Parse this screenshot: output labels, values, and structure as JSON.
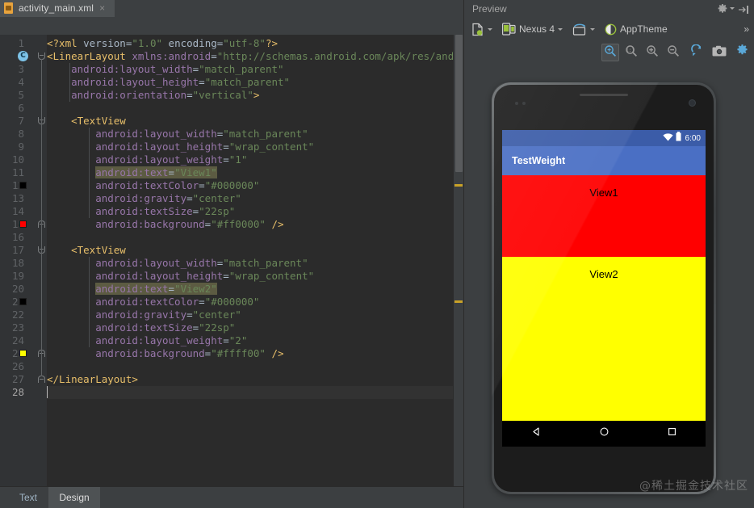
{
  "editor": {
    "tab": {
      "filename": "activity_main.xml",
      "close_glyph": "×",
      "icon": "xml-file-icon"
    },
    "bottom_tabs": [
      {
        "label": "Text",
        "active": false
      },
      {
        "label": "Design",
        "active": true
      }
    ],
    "caret_line": 28,
    "lines": [
      {
        "n": 1,
        "tokens": [
          {
            "t": "<?xml ",
            "c": "tag"
          },
          {
            "t": "version",
            "c": "plain"
          },
          {
            "t": "=",
            "c": "plain"
          },
          {
            "t": "\"1.0\"",
            "c": "val"
          },
          {
            "t": " encoding",
            "c": "plain"
          },
          {
            "t": "=",
            "c": "plain"
          },
          {
            "t": "\"utf-8\"",
            "c": "val"
          },
          {
            "t": "?>",
            "c": "tag"
          }
        ]
      },
      {
        "n": 2,
        "indent": 0,
        "tokens": [
          {
            "t": "<LinearLayout",
            "c": "tag"
          },
          {
            "t": " xmlns:android",
            "c": "attr"
          },
          {
            "t": "=",
            "c": "plain"
          },
          {
            "t": "\"http://schemas.android.com/apk/res/android\"",
            "c": "val"
          }
        ]
      },
      {
        "n": 3,
        "tokens": [
          {
            "t": "    android:layout_width",
            "c": "attr"
          },
          {
            "t": "=",
            "c": "plain"
          },
          {
            "t": "\"match_parent\"",
            "c": "val"
          }
        ]
      },
      {
        "n": 4,
        "tokens": [
          {
            "t": "    android:layout_height",
            "c": "attr"
          },
          {
            "t": "=",
            "c": "plain"
          },
          {
            "t": "\"match_parent\"",
            "c": "val"
          }
        ]
      },
      {
        "n": 5,
        "tokens": [
          {
            "t": "    android:orientation",
            "c": "attr"
          },
          {
            "t": "=",
            "c": "plain"
          },
          {
            "t": "\"vertical\"",
            "c": "val"
          },
          {
            "t": ">",
            "c": "tag"
          }
        ]
      },
      {
        "n": 6,
        "tokens": []
      },
      {
        "n": 7,
        "tokens": [
          {
            "t": "    <TextView",
            "c": "tag"
          }
        ]
      },
      {
        "n": 8,
        "tokens": [
          {
            "t": "        android:layout_width",
            "c": "attr"
          },
          {
            "t": "=",
            "c": "plain"
          },
          {
            "t": "\"match_parent\"",
            "c": "val"
          }
        ]
      },
      {
        "n": 9,
        "tokens": [
          {
            "t": "        android:layout_height",
            "c": "attr"
          },
          {
            "t": "=",
            "c": "plain"
          },
          {
            "t": "\"wrap_content\"",
            "c": "val"
          }
        ]
      },
      {
        "n": 10,
        "tokens": [
          {
            "t": "        android:layout_weight",
            "c": "attr"
          },
          {
            "t": "=",
            "c": "plain"
          },
          {
            "t": "\"1\"",
            "c": "val"
          }
        ]
      },
      {
        "n": 11,
        "tokens": [
          {
            "t": "        ",
            "c": "plain"
          },
          {
            "t": "android:text",
            "c": "attr",
            "hl": true
          },
          {
            "t": "=",
            "c": "plain",
            "hl": true
          },
          {
            "t": "\"View1\"",
            "c": "val",
            "hl": true
          }
        ]
      },
      {
        "n": 12,
        "tokens": [
          {
            "t": "        android:textColor",
            "c": "attr"
          },
          {
            "t": "=",
            "c": "plain"
          },
          {
            "t": "\"#000000\"",
            "c": "val"
          }
        ]
      },
      {
        "n": 13,
        "tokens": [
          {
            "t": "        android:gravity",
            "c": "attr"
          },
          {
            "t": "=",
            "c": "plain"
          },
          {
            "t": "\"center\"",
            "c": "val"
          }
        ]
      },
      {
        "n": 14,
        "tokens": [
          {
            "t": "        android:textSize",
            "c": "attr"
          },
          {
            "t": "=",
            "c": "plain"
          },
          {
            "t": "\"22sp\"",
            "c": "val"
          }
        ]
      },
      {
        "n": 15,
        "tokens": [
          {
            "t": "        android:background",
            "c": "attr"
          },
          {
            "t": "=",
            "c": "plain"
          },
          {
            "t": "\"#ff0000\"",
            "c": "val"
          },
          {
            "t": " ",
            "c": "plain"
          },
          {
            "t": "/>",
            "c": "tag"
          }
        ]
      },
      {
        "n": 16,
        "tokens": []
      },
      {
        "n": 17,
        "tokens": [
          {
            "t": "    <TextView",
            "c": "tag"
          }
        ]
      },
      {
        "n": 18,
        "tokens": [
          {
            "t": "        android:layout_width",
            "c": "attr"
          },
          {
            "t": "=",
            "c": "plain"
          },
          {
            "t": "\"match_parent\"",
            "c": "val"
          }
        ]
      },
      {
        "n": 19,
        "tokens": [
          {
            "t": "        android:layout_height",
            "c": "attr"
          },
          {
            "t": "=",
            "c": "plain"
          },
          {
            "t": "\"wrap_content\"",
            "c": "val"
          }
        ]
      },
      {
        "n": 20,
        "tokens": [
          {
            "t": "        ",
            "c": "plain"
          },
          {
            "t": "android:text",
            "c": "attr",
            "hl": true
          },
          {
            "t": "=",
            "c": "plain",
            "hl": true
          },
          {
            "t": "\"View2\"",
            "c": "val",
            "hl": true
          }
        ]
      },
      {
        "n": 21,
        "tokens": [
          {
            "t": "        android:textColor",
            "c": "attr"
          },
          {
            "t": "=",
            "c": "plain"
          },
          {
            "t": "\"#000000\"",
            "c": "val"
          }
        ]
      },
      {
        "n": 22,
        "tokens": [
          {
            "t": "        android:gravity",
            "c": "attr"
          },
          {
            "t": "=",
            "c": "plain"
          },
          {
            "t": "\"center\"",
            "c": "val"
          }
        ]
      },
      {
        "n": 23,
        "tokens": [
          {
            "t": "        android:textSize",
            "c": "attr"
          },
          {
            "t": "=",
            "c": "plain"
          },
          {
            "t": "\"22sp\"",
            "c": "val"
          }
        ]
      },
      {
        "n": 24,
        "tokens": [
          {
            "t": "        android:layout_weight",
            "c": "attr"
          },
          {
            "t": "=",
            "c": "plain"
          },
          {
            "t": "\"2\"",
            "c": "val"
          }
        ]
      },
      {
        "n": 25,
        "tokens": [
          {
            "t": "        android:background",
            "c": "attr"
          },
          {
            "t": "=",
            "c": "plain"
          },
          {
            "t": "\"#ffff00\"",
            "c": "val"
          },
          {
            "t": " ",
            "c": "plain"
          },
          {
            "t": "/>",
            "c": "tag"
          }
        ]
      },
      {
        "n": 26,
        "tokens": []
      },
      {
        "n": 27,
        "tokens": [
          {
            "t": "</LinearLayout>",
            "c": "tag"
          }
        ]
      },
      {
        "n": 28,
        "tokens": []
      }
    ],
    "gutter_swatches": [
      {
        "line": 12,
        "color": "#000000",
        "name": "color-swatch-black"
      },
      {
        "line": 15,
        "color": "#ff0000",
        "name": "color-swatch-red"
      },
      {
        "line": 21,
        "color": "#000000",
        "name": "color-swatch-black"
      },
      {
        "line": 25,
        "color": "#ffff00",
        "name": "color-swatch-yellow"
      }
    ],
    "gutter_badges": [
      {
        "line": 2,
        "glyph": "C",
        "name": "class-badge"
      }
    ],
    "fold_markers": [
      {
        "line": 2,
        "type": "open"
      },
      {
        "line": 7,
        "type": "open"
      },
      {
        "line": 15,
        "type": "close"
      },
      {
        "line": 17,
        "type": "open"
      },
      {
        "line": 25,
        "type": "close"
      },
      {
        "line": 27,
        "type": "close"
      }
    ],
    "warning_markers": [
      {
        "line": 12,
        "color": "#c9a227"
      },
      {
        "line": 21,
        "color": "#c9a227"
      }
    ]
  },
  "preview": {
    "title": "Preview",
    "gear_icon": "gear-icon",
    "collapse_icon": "collapse-right-icon",
    "overflow_glyph": "»",
    "toolbar": [
      {
        "name": "device-config-dropdown",
        "icon": "android-config-icon",
        "label": ""
      },
      {
        "name": "device-dropdown",
        "icon": "device-icon",
        "label": "Nexus 4"
      },
      {
        "name": "orientation-dropdown",
        "icon": "orientation-icon",
        "label": ""
      },
      {
        "name": "theme-dropdown",
        "icon": "theme-icon",
        "label": "AppTheme"
      }
    ],
    "zoom_buttons": [
      {
        "name": "zoom-to-fit-button",
        "icon": "zoom-fit-icon",
        "selected": true
      },
      {
        "name": "zoom-actual-size-button",
        "icon": "zoom-1to1-icon",
        "selected": false
      },
      {
        "name": "zoom-in-button",
        "icon": "zoom-in-icon",
        "selected": false
      },
      {
        "name": "zoom-out-button",
        "icon": "zoom-out-icon",
        "selected": false
      },
      {
        "name": "refresh-button",
        "icon": "refresh-icon",
        "selected": false
      },
      {
        "name": "screenshot-button",
        "icon": "camera-icon",
        "selected": false
      },
      {
        "name": "preview-settings-button",
        "icon": "gear-icon",
        "selected": false
      }
    ],
    "device": {
      "status_bar": {
        "time": "6:00",
        "wifi_icon": "wifi-icon",
        "battery_icon": "battery-icon",
        "bg": "#3b5ca8"
      },
      "app_bar": {
        "title": "TestWeight",
        "bg": "#4a6fc4"
      },
      "views": [
        {
          "name": "view1",
          "text": "View1",
          "bg": "#ff0000",
          "weight": 1
        },
        {
          "name": "view2",
          "text": "View2",
          "bg": "#ffff00",
          "weight": 2
        }
      ],
      "nav_bar": [
        {
          "name": "nav-back-button",
          "icon": "back-triangle-icon"
        },
        {
          "name": "nav-home-button",
          "icon": "home-circle-icon"
        },
        {
          "name": "nav-recents-button",
          "icon": "recents-square-icon"
        }
      ]
    }
  },
  "watermark": {
    "text": "@稀土掘金技术社区"
  }
}
